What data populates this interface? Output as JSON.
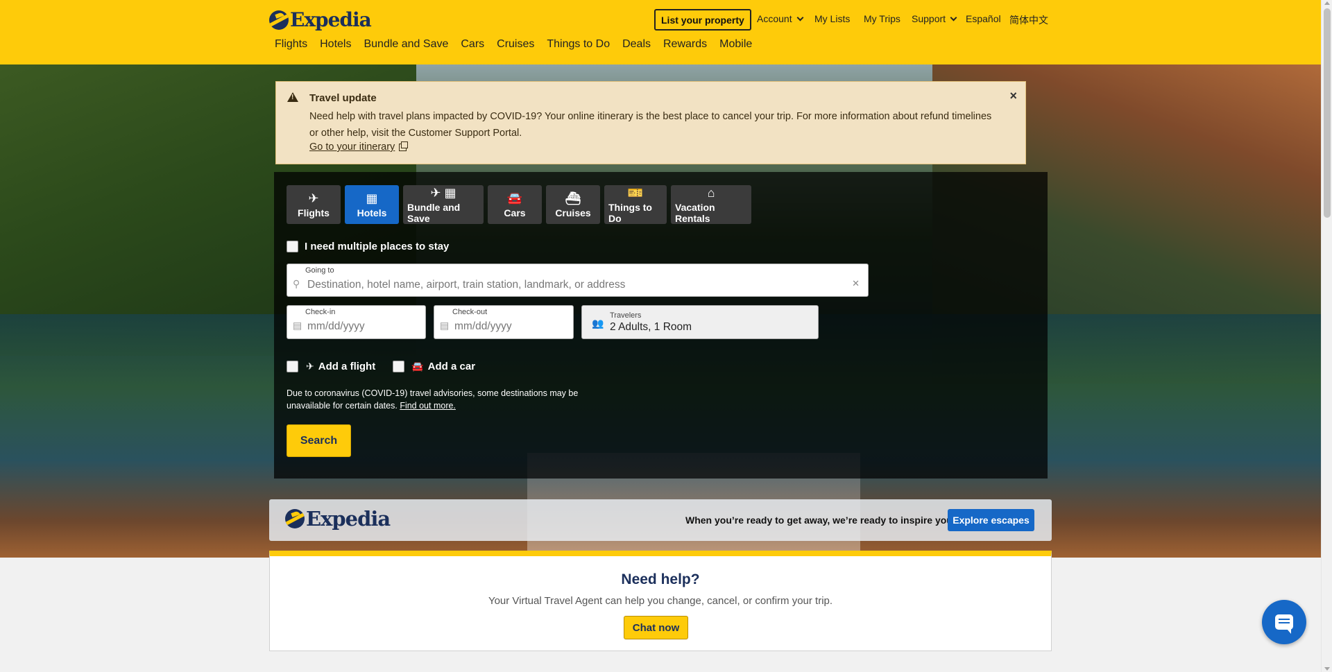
{
  "header": {
    "logo_text": "Expedia",
    "list_property": "List your property",
    "account": "Account",
    "my_lists": "My Lists",
    "my_trips": "My Trips",
    "support": "Support",
    "espanol": "Español",
    "chinese": "简体中文",
    "nav": [
      "Flights",
      "Hotels",
      "Bundle and Save",
      "Cars",
      "Cruises",
      "Things to Do",
      "Deals",
      "Rewards",
      "Mobile"
    ],
    "brand_color": "#fecb0a"
  },
  "alert": {
    "title": "Travel update",
    "body": "Need help with travel plans impacted by COVID-19? Your online itinerary is the best place to cancel your trip. For more information about refund timelines or other help, visit the Customer Support Portal.",
    "link": "Go to your itinerary",
    "close_icon": "close-icon"
  },
  "search": {
    "tabs": [
      {
        "label": "Flights",
        "icon": "✈",
        "active": false
      },
      {
        "label": "Hotels",
        "icon": "▦",
        "active": true
      },
      {
        "label": "Bundle and Save",
        "icon": "✈ ▦",
        "active": false
      },
      {
        "label": "Cars",
        "icon": "🚘",
        "active": false
      },
      {
        "label": "Cruises",
        "icon": "⛴",
        "active": false
      },
      {
        "label": "Things to Do",
        "icon": "🎫",
        "active": false
      },
      {
        "label": "Vacation Rentals",
        "icon": "⌂",
        "active": false
      }
    ],
    "multiple_places": "I need multiple places to stay",
    "going_to_label": "Going to",
    "going_to_placeholder": "Destination, hotel name, airport, train station, landmark, or address",
    "checkin_label": "Check-in",
    "checkin_placeholder": "mm/dd/yyyy",
    "checkout_label": "Check-out",
    "checkout_placeholder": "mm/dd/yyyy",
    "travelers_label": "Travelers",
    "travelers_value": "2 Adults, 1 Room",
    "add_flight": "Add a flight",
    "add_car": "Add a car",
    "covid_note": "Due to coronavirus (COVID-19) travel advisories, some destinations may be unavailable for certain dates.",
    "covid_link": "Find out more.",
    "search_button": "Search",
    "active_color": "#1668c7"
  },
  "inspire": {
    "logo_text": "Expedia",
    "text": "When you’re ready to get away, we’re ready to inspire you.",
    "button": "Explore escapes"
  },
  "help": {
    "title": "Need help?",
    "text": "Your Virtual Travel Agent can help you change, cancel, or confirm your trip.",
    "button": "Chat now"
  }
}
